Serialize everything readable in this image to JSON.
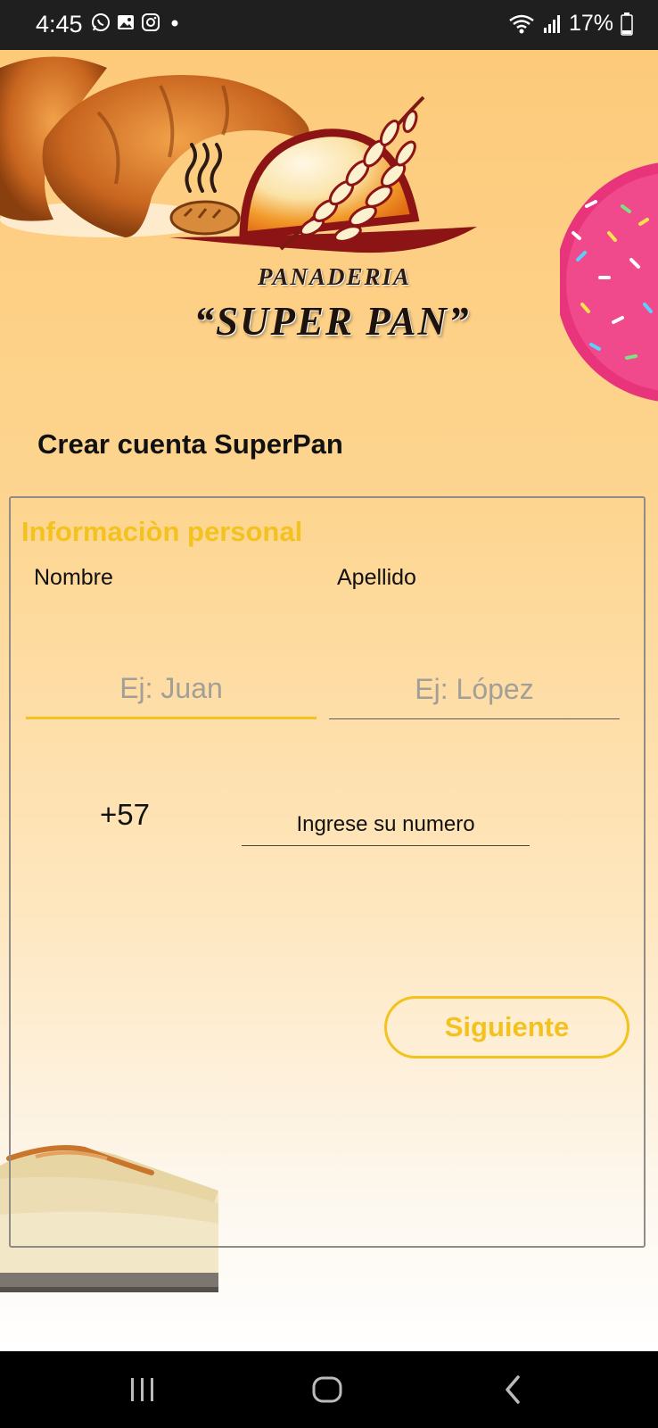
{
  "status_bar": {
    "time": "4:45",
    "battery": "17%",
    "icons": [
      "whatsapp-icon",
      "gallery-icon",
      "instagram-icon",
      "notification-dot-icon",
      "wifi-icon",
      "signal-icon",
      "battery-icon"
    ]
  },
  "brand": {
    "line1": "PANADERIA",
    "line2": "“SUPER PAN”"
  },
  "page": {
    "title": "Crear cuenta SuperPan"
  },
  "form": {
    "section_title": "Informaciòn personal",
    "first_name": {
      "label": "Nombre",
      "placeholder": "Ej: Juan",
      "value": ""
    },
    "last_name": {
      "label": "Apellido",
      "placeholder": "Ej: López",
      "value": ""
    },
    "phone": {
      "country_code": "+57",
      "placeholder": "Ingrese su numero",
      "value": ""
    },
    "next_label": "Siguiente"
  },
  "nav": {
    "items": [
      "recent-apps-icon",
      "home-icon",
      "back-icon"
    ]
  },
  "colors": {
    "accent": "#f3c21e",
    "status_bar": "#1f1f1f",
    "nav_bar": "#000000",
    "background_top": "#fdca7a",
    "background_bottom": "#ffffff"
  }
}
